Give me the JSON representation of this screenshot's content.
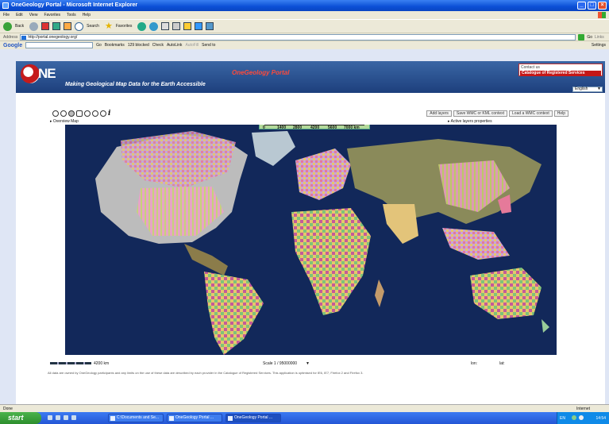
{
  "window": {
    "title": "OneGeology Portal - Microsoft Internet Explorer",
    "buttons": [
      "_",
      "□",
      "×"
    ]
  },
  "menu": [
    "File",
    "Edit",
    "View",
    "Favorites",
    "Tools",
    "Help"
  ],
  "toolbar": {
    "back": "Back",
    "search": "Search",
    "favorites": "Favorites"
  },
  "address": {
    "label": "Address",
    "url": "http://portal.onegeology.org/",
    "go": "Go",
    "links": "Links"
  },
  "googlebar": {
    "logo": "Google",
    "go": "Go",
    "bookmarks": "Bookmarks",
    "blocked": "129 blocked",
    "check": "Check",
    "autolink": "AutoLink",
    "autofill": "AutoFill",
    "sendto": "Send to",
    "settings": "Settings"
  },
  "header": {
    "logo_text": "NE",
    "tagline": "Making Geological Map Data for the Earth Accessible",
    "portal_title": "OneGeology Portal",
    "contact": "Contact us",
    "catalogue": "Catalogue of Registered Services",
    "language": "English"
  },
  "map": {
    "top_buttons": [
      "Add layers",
      "Save WMC or KML context",
      "Load a WMC context",
      "Help"
    ],
    "overview": "Overview Map",
    "layer_props": "Active layers properties",
    "scale_top_labels": [
      "0",
      "1400",
      "2800",
      "4200",
      "5600",
      "7000 km"
    ],
    "scalebar_label": "4200 km",
    "scale": "Scale 1 / 95000000",
    "lon": "lon:",
    "lat": "lat:",
    "disclaimer": "All data are owned by OneGeology participants and any limits on the use of these data are described by each provider in the Catalogue of Registered Services. This application is optimised for IE6, IE7, Firefox 2 and Firefox 3."
  },
  "status": {
    "done": "Done",
    "zone": "Internet"
  },
  "taskbar": {
    "start": "start",
    "tasks": [
      "C:\\Documents and Se...",
      "OneGeology Portal ...",
      "OneGeology Portal ..."
    ],
    "lang": "EN",
    "clock": "14:54"
  },
  "colors": {
    "header_blue": "#2a4f8f",
    "title_red": "#ff4a3a",
    "ocean": "#122a55",
    "xp_blue": "#0b4fd6"
  }
}
